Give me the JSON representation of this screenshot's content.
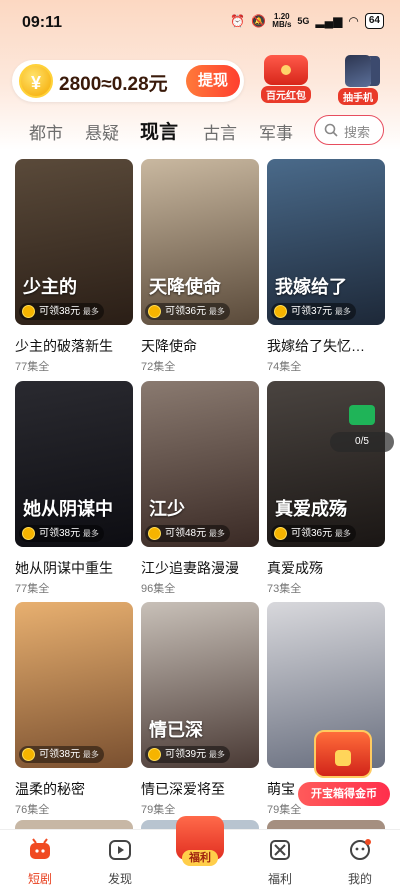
{
  "status_bar": {
    "time": "09:11",
    "net_speed": "1.20\nMB/s",
    "signal": "5G",
    "battery": "64"
  },
  "header": {
    "coin_text": "2800≈0.28元",
    "withdraw_label": "提现",
    "promo_hongbao_label": "百元红包",
    "promo_phone_label": "抽手机"
  },
  "categories": [
    "都市",
    "悬疑",
    "现言",
    "古言",
    "军事"
  ],
  "active_category": "现言",
  "search": {
    "placeholder": "搜索"
  },
  "dramas": [
    {
      "title": "少主的破落新生",
      "episodes": "77集全",
      "reward": "可领38元",
      "tag": "最多",
      "cover_text": "少主的",
      "colors": [
        "#5a4a3a",
        "#2a1e16"
      ]
    },
    {
      "title": "天降使命",
      "episodes": "72集全",
      "reward": "可领36元",
      "tag": "最多",
      "cover_text": "天降使命",
      "colors": [
        "#c9b8a0",
        "#5a4a3a"
      ]
    },
    {
      "title": "我嫁给了失忆…",
      "episodes": "74集全",
      "reward": "可领37元",
      "tag": "最多",
      "cover_text": "我嫁给了",
      "colors": [
        "#4a6a8a",
        "#1d2838"
      ]
    },
    {
      "title": "她从阴谋中重生",
      "episodes": "77集全",
      "reward": "可领38元",
      "tag": "最多",
      "cover_text": "她从阴谋中",
      "colors": [
        "#2a2a30",
        "#0d0d12"
      ]
    },
    {
      "title": "江少追妻路漫漫",
      "episodes": "96集全",
      "reward": "可领48元",
      "tag": "最多",
      "cover_text": "江少",
      "colors": [
        "#8a7a70",
        "#3a2a25"
      ]
    },
    {
      "title": "真爱成殇",
      "episodes": "73集全",
      "reward": "可领36元",
      "tag": "最多",
      "cover_text": "真爱成殇",
      "colors": [
        "#4a4440",
        "#1a1614"
      ]
    },
    {
      "title": "温柔的秘密",
      "episodes": "76集全",
      "reward": "可领38元",
      "tag": "最多",
      "cover_text": "",
      "colors": [
        "#e8b070",
        "#7a5030"
      ]
    },
    {
      "title": "情已深爱将至",
      "episodes": "79集全",
      "reward": "可领39元",
      "tag": "最多",
      "cover_text": "情已深",
      "colors": [
        "#c8c0b8",
        "#4a3a35"
      ]
    },
    {
      "title": "萌宝",
      "episodes": "79集全",
      "reward": "",
      "tag": "",
      "cover_text": "",
      "colors": [
        "#d8d8dc",
        "#6a7080"
      ]
    }
  ],
  "overlay": {
    "progress": "0/5",
    "chest_label": "开宝箱得金币"
  },
  "bottom_nav": [
    {
      "label": "短剧",
      "icon": "drama-icon",
      "active": true
    },
    {
      "label": "发现",
      "icon": "play-icon",
      "active": false
    },
    {
      "label": "福利",
      "icon": "hongbao-icon",
      "active": false
    },
    {
      "label": "福利",
      "icon": "gift-icon",
      "active": false
    },
    {
      "label": "我的",
      "icon": "profile-icon",
      "active": false
    }
  ],
  "colors": {
    "accent": "#e8401f",
    "search_border": "#e74d5e",
    "coin": "#f5a800"
  }
}
